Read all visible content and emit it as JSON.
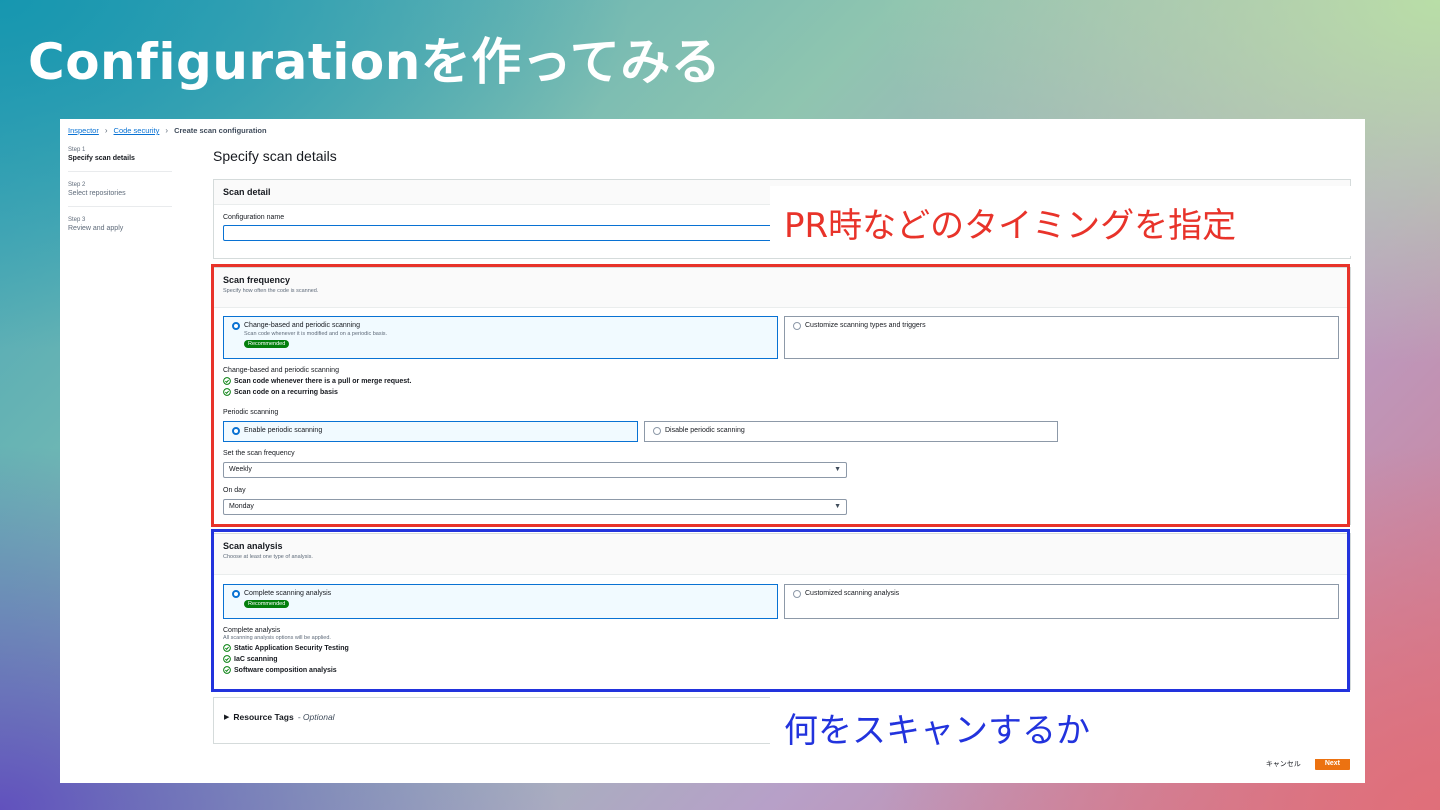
{
  "slide": {
    "title": "Configurationを作ってみる"
  },
  "breadcrumb": {
    "items": [
      "Inspector",
      "Code security"
    ],
    "current": "Create scan configuration"
  },
  "steps": [
    {
      "num": "Step 1",
      "name": "Specify scan details"
    },
    {
      "num": "Step 2",
      "name": "Select repositories"
    },
    {
      "num": "Step 3",
      "name": "Review and apply"
    }
  ],
  "page": {
    "heading": "Specify scan details"
  },
  "scan_detail": {
    "title": "Scan detail",
    "config_name_label": "Configuration name",
    "config_name_value": ""
  },
  "scan_frequency": {
    "title": "Scan frequency",
    "desc": "Specify how often the code is scanned.",
    "tile_a": {
      "label": "Change-based and periodic scanning",
      "desc": "Scan code whenever it is modified and on a periodic basis.",
      "badge": "Recommended"
    },
    "tile_b": {
      "label": "Customize scanning types and triggers"
    },
    "summary_label": "Change-based and periodic scanning",
    "checks": [
      "Scan code whenever there is a pull or merge request.",
      "Scan code on a recurring basis"
    ],
    "periodic_label": "Periodic scanning",
    "periodic_a": "Enable periodic scanning",
    "periodic_b": "Disable periodic scanning",
    "freq_label": "Set the scan frequency",
    "freq_value": "Weekly",
    "day_label": "On day",
    "day_value": "Monday"
  },
  "scan_analysis": {
    "title": "Scan analysis",
    "desc": "Choose at least one type of analysis.",
    "tile_a": {
      "label": "Complete scanning analysis",
      "badge": "Recommended"
    },
    "tile_b": {
      "label": "Customized scanning analysis"
    },
    "summary_label": "Complete analysis",
    "summary_desc": "All scanning analysis options will be applied.",
    "checks": [
      "Static Application Security Testing",
      "IaC scanning",
      "Software composition analysis"
    ]
  },
  "resource_tags": {
    "title": "Resource Tags",
    "optional": "- Optional"
  },
  "footer": {
    "cancel": "キャンセル",
    "next": "Next"
  },
  "annotations": {
    "red": "PR時などのタイミングを指定",
    "blue": "何をスキャンするか"
  },
  "colors": {
    "annot_red": "#e8332a",
    "annot_blue": "#2233dd",
    "accent": "#0972d3",
    "next": "#ec7211",
    "badge": "#037f0c"
  }
}
